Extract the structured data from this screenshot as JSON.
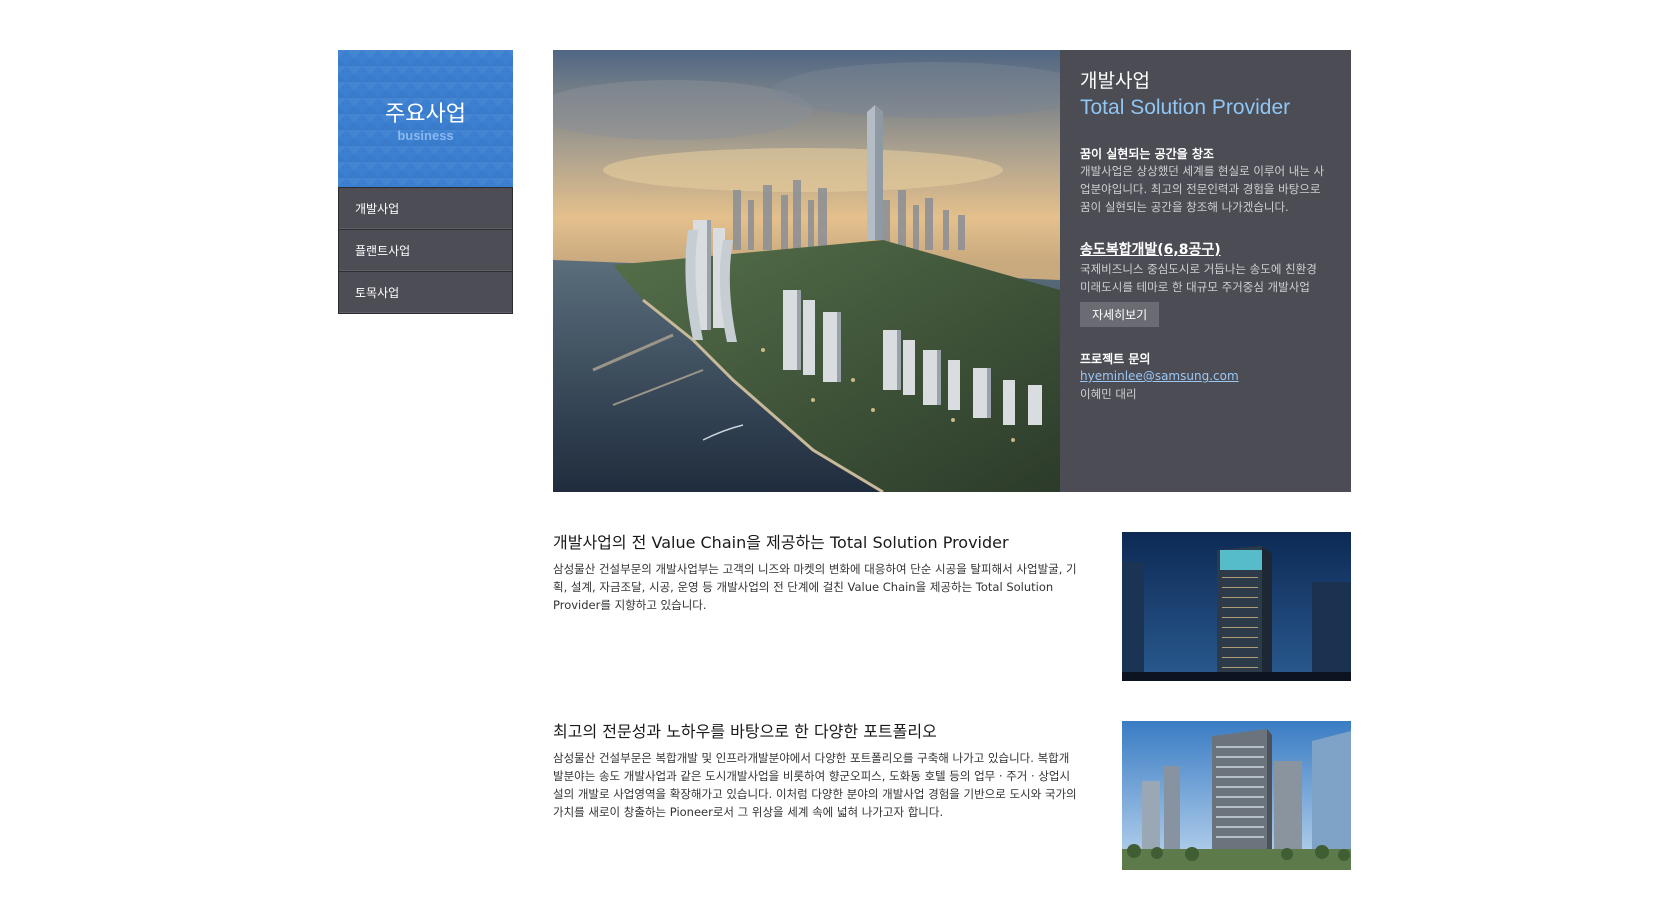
{
  "sidebar": {
    "title": "주요사업",
    "subtitle": "business",
    "items": [
      {
        "label": "개발사업"
      },
      {
        "label": "플랜트사업"
      },
      {
        "label": "토목사업"
      }
    ]
  },
  "hero": {
    "title": "개발사업",
    "subtitle": "Total Solution Provider",
    "intro_heading": "꿈이 실현되는 공간을 창조",
    "intro_text": "개발사업은 상상했던 세계를 현실로 이루어 내는 사업분야입니다. 최고의 전문인력과 경험을 바탕으로 꿈이 실현되는 공간을 창조해 나가겠습니다.",
    "project_link": "송도복합개발(6,8공구)",
    "project_text": "국제비즈니스 중심도시로 거듭나는 송도에 친환경 미래도시를 테마로 한 대규모 주거중심 개발사업",
    "detail_button": "자세히보기",
    "contact_heading": "프로젝트 문의",
    "contact_email": "hyeminlee@samsung.com",
    "contact_name": "이혜민 대리"
  },
  "sections": [
    {
      "title": "개발사업의 전 Value Chain을 제공하는 Total Solution Provider",
      "body": "삼성물산 건설부문의 개발사업부는 고객의 니즈와 마켓의 변화에 대응하여 단순 시공을 탈피해서 사업발굴, 기획, 설계, 자금조달, 시공, 운영 등 개발사업의 전 단계에 걸친 Value Chain을 제공하는 Total Solution Provider를 지향하고 있습니다."
    },
    {
      "title": "최고의 전문성과 노하우를 바탕으로 한 다양한 포트폴리오",
      "body": "삼성물산 건설부문은 복합개발 및 인프라개발분야에서 다양한 포트폴리오를 구축해 나가고 있습니다. 복합개발분야는 송도 개발사업과 같은 도시개발사업을 비롯하여 향군오피스, 도화동 호텔 등의 업무 · 주거 · 상업시설의 개발로 사업영역을 확장해가고 있습니다. 이처럼 다양한 분야의 개발사업 경험을 기반으로 도시와 국가의 가치를 새로이 창출하는 Pioneer로서 그 위상을 세계 속에 넓혀 나가고자 합니다."
    }
  ],
  "colors": {
    "sidebar_header": "#3b7fd1",
    "sidebar_menu": "#4c4d55",
    "hero_panel": "#4b4c54",
    "accent_blue": "#8fc6f4"
  }
}
